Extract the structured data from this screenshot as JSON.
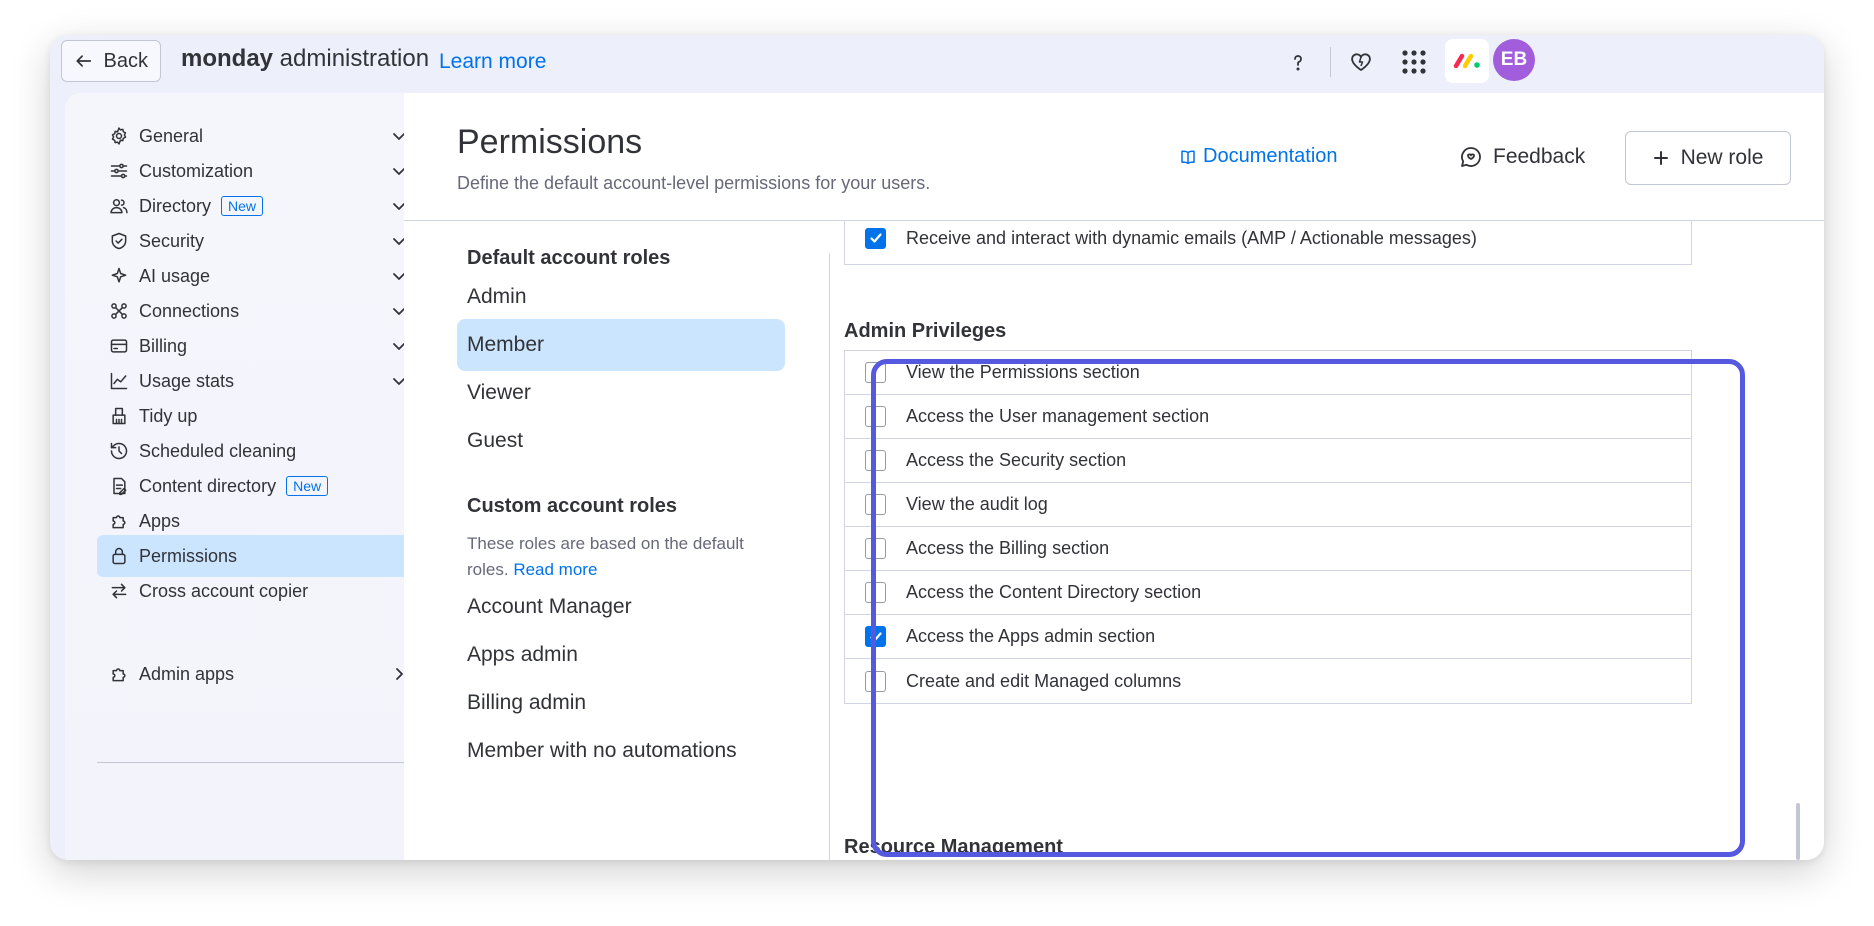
{
  "topbar": {
    "back_label": "Back",
    "brand_bold": "monday",
    "brand_rest": " administration",
    "learn_more": "Learn more",
    "avatar_initials": "EB",
    "icons": [
      "help-icon",
      "heart-icon",
      "apps-grid-icon",
      "monday-logo"
    ]
  },
  "sidebar": {
    "items": [
      {
        "label": "General",
        "icon": "gear-icon",
        "chevron": "down"
      },
      {
        "label": "Customization",
        "icon": "sliders-icon",
        "chevron": "down"
      },
      {
        "label": "Directory",
        "icon": "users-icon",
        "chevron": "down",
        "badge": "New"
      },
      {
        "label": "Security",
        "icon": "shield-icon",
        "chevron": "down"
      },
      {
        "label": "AI usage",
        "icon": "sparkle-icon",
        "chevron": "down"
      },
      {
        "label": "Connections",
        "icon": "connections-icon",
        "chevron": "down"
      },
      {
        "label": "Billing",
        "icon": "credit-card-icon",
        "chevron": "down"
      },
      {
        "label": "Usage stats",
        "icon": "chart-icon",
        "chevron": "down"
      },
      {
        "label": "Tidy up",
        "icon": "broom-icon"
      },
      {
        "label": "Scheduled cleaning",
        "icon": "history-icon"
      },
      {
        "label": "Content directory",
        "icon": "document-icon",
        "badge": "New"
      },
      {
        "label": "Apps",
        "icon": "puzzle-icon"
      },
      {
        "label": "Permissions",
        "icon": "lock-icon",
        "active": true
      },
      {
        "label": "Cross account copier",
        "icon": "swap-icon"
      },
      {
        "label": "Admin apps",
        "icon": "puzzle-icon",
        "chevron": "right"
      }
    ]
  },
  "header": {
    "title": "Permissions",
    "subtitle": "Define the default account-level permissions for your users.",
    "documentation": "Documentation",
    "feedback": "Feedback",
    "new_role": "New role"
  },
  "roles": {
    "default_heading": "Default account roles",
    "default": [
      "Admin",
      "Member",
      "Viewer",
      "Guest"
    ],
    "active_role": "Member",
    "custom_heading": "Custom account roles",
    "custom_desc": "These roles are based on the default roles.",
    "read_more": "Read more",
    "custom": [
      "Account Manager",
      "Apps admin",
      "Billing admin",
      "Member with no automations"
    ]
  },
  "permissions": {
    "top_row": {
      "label": "Receive and interact with dynamic emails (AMP / Actionable messages)",
      "checked": true
    },
    "admin_title": "Admin Privileges",
    "admin_rows": [
      {
        "label": "View the Permissions section",
        "checked": false
      },
      {
        "label": "Access the User management section",
        "checked": false
      },
      {
        "label": "Access the Security section",
        "checked": false
      },
      {
        "label": "View the audit log",
        "checked": false
      },
      {
        "label": "Access the Billing section",
        "checked": false
      },
      {
        "label": "Access the Content Directory section",
        "checked": false
      },
      {
        "label": "Access the Apps admin section",
        "checked": true
      },
      {
        "label": "Create and edit Managed columns",
        "checked": false
      }
    ],
    "next_title": "Resource Management"
  },
  "colors": {
    "accent": "#0073ea",
    "highlight": "#5559df",
    "active_bg": "#cce5ff",
    "avatar": "#a25ddc"
  }
}
